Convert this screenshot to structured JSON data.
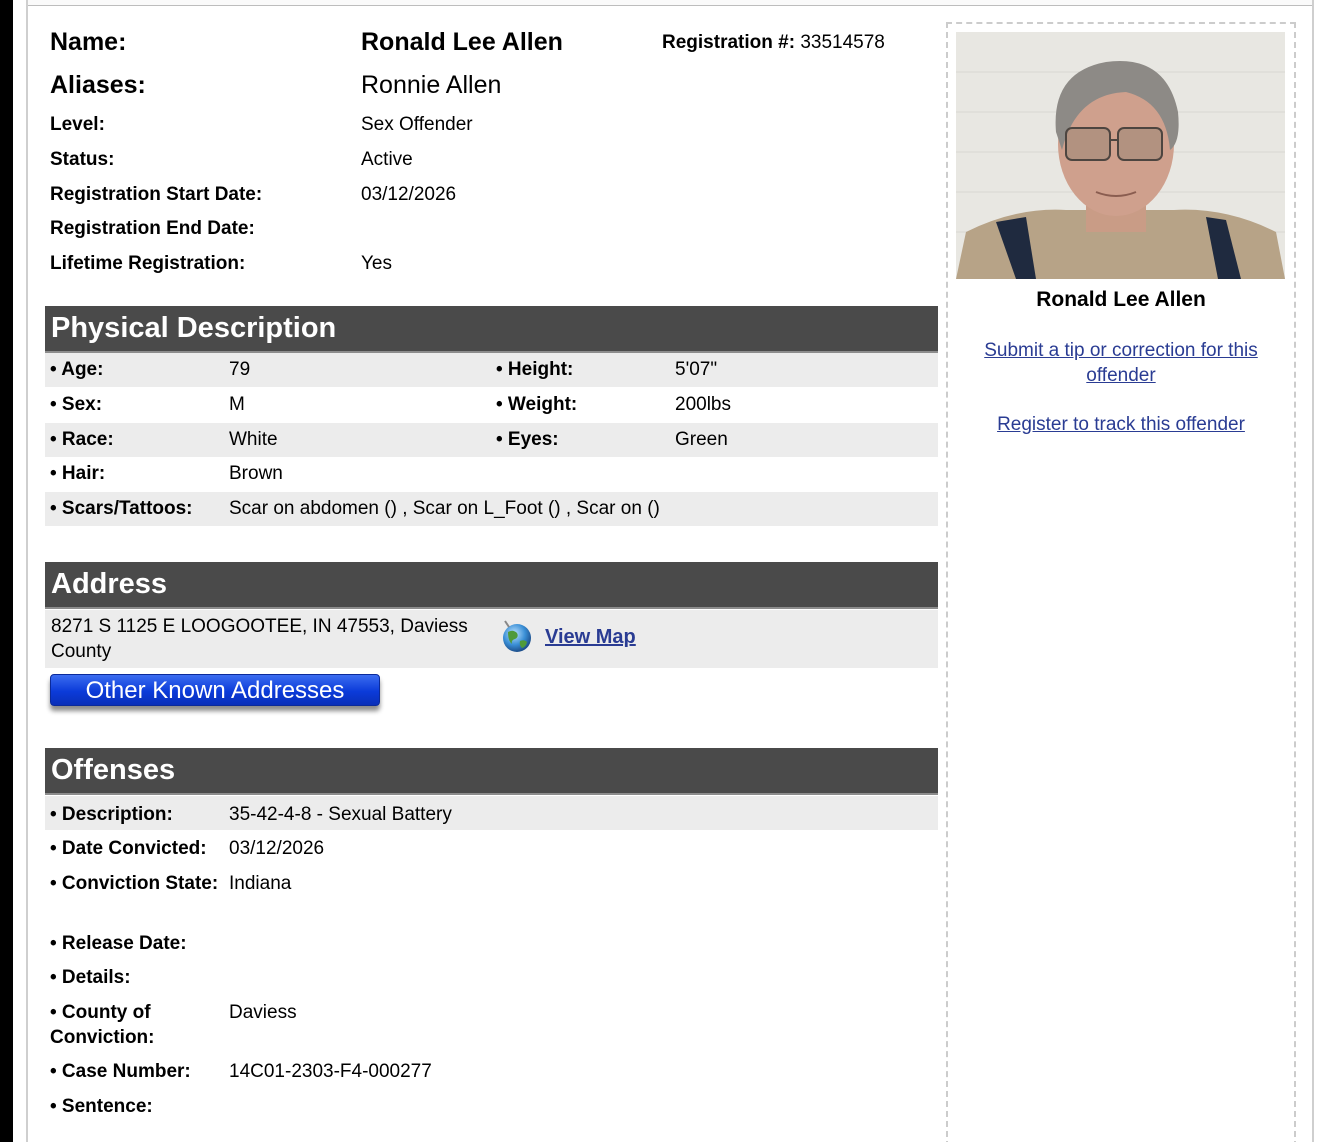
{
  "header": {
    "name_label": "Name:",
    "name_value": "Ronald Lee Allen",
    "registration_label": "Registration #:",
    "registration_value": "33514578",
    "aliases_label": "Aliases:",
    "aliases_value": "Ronnie Allen",
    "level_label": "Level:",
    "level_value": "Sex Offender",
    "status_label": "Status:",
    "status_value": "Active",
    "start_label": "Registration Start Date:",
    "start_value": "03/12/2026",
    "end_label": "Registration End Date:",
    "end_value": "",
    "lifetime_label": "Lifetime Registration:",
    "lifetime_value": "Yes"
  },
  "physical": {
    "title": "Physical Description",
    "age_label": "• Age:",
    "age_value": "79",
    "height_label": "• Height:",
    "height_value": "5'07\"",
    "sex_label": "• Sex:",
    "sex_value": "M",
    "weight_label": "• Weight:",
    "weight_value": "200lbs",
    "race_label": "• Race:",
    "race_value": "White",
    "eyes_label": "• Eyes:",
    "eyes_value": "Green",
    "hair_label": "• Hair:",
    "hair_value": "Brown",
    "scars_label": "• Scars/Tattoos:",
    "scars_value": "Scar on abdomen () , Scar on L_Foot () , Scar on ()"
  },
  "address": {
    "title": "Address",
    "text": "8271 S 1125 E LOOGOOTEE, IN 47553, Daviess County",
    "view_map": "View Map",
    "other_button": "Other Known Addresses",
    "globe_icon": "globe-icon"
  },
  "offenses": {
    "title": "Offenses",
    "description_label": "• Description:",
    "description_value": "35-42-4-8 - Sexual Battery",
    "date_label": "• Date Convicted:",
    "date_value": "03/12/2026",
    "state_label": "• Conviction State:",
    "state_value": "Indiana",
    "release_label": "• Release Date:",
    "release_value": "",
    "details_label": "• Details:",
    "details_value": "",
    "county_label": "• County of Conviction:",
    "county_value": "Daviess",
    "case_label": "• Case Number:",
    "case_value": "14C01-2303-F4-000277",
    "sentence_label": "• Sentence:",
    "sentence_value": ""
  },
  "sidebar": {
    "photo_name": "Ronald Lee Allen",
    "tip_link": "Submit a tip or correction for this offender",
    "track_link": "Register to track this offender"
  },
  "colors": {
    "section_header_bg": "#4a4a4a",
    "row_shade": "#ececec",
    "link": "#2a3c93",
    "button_blue": "#0b3bd9"
  }
}
